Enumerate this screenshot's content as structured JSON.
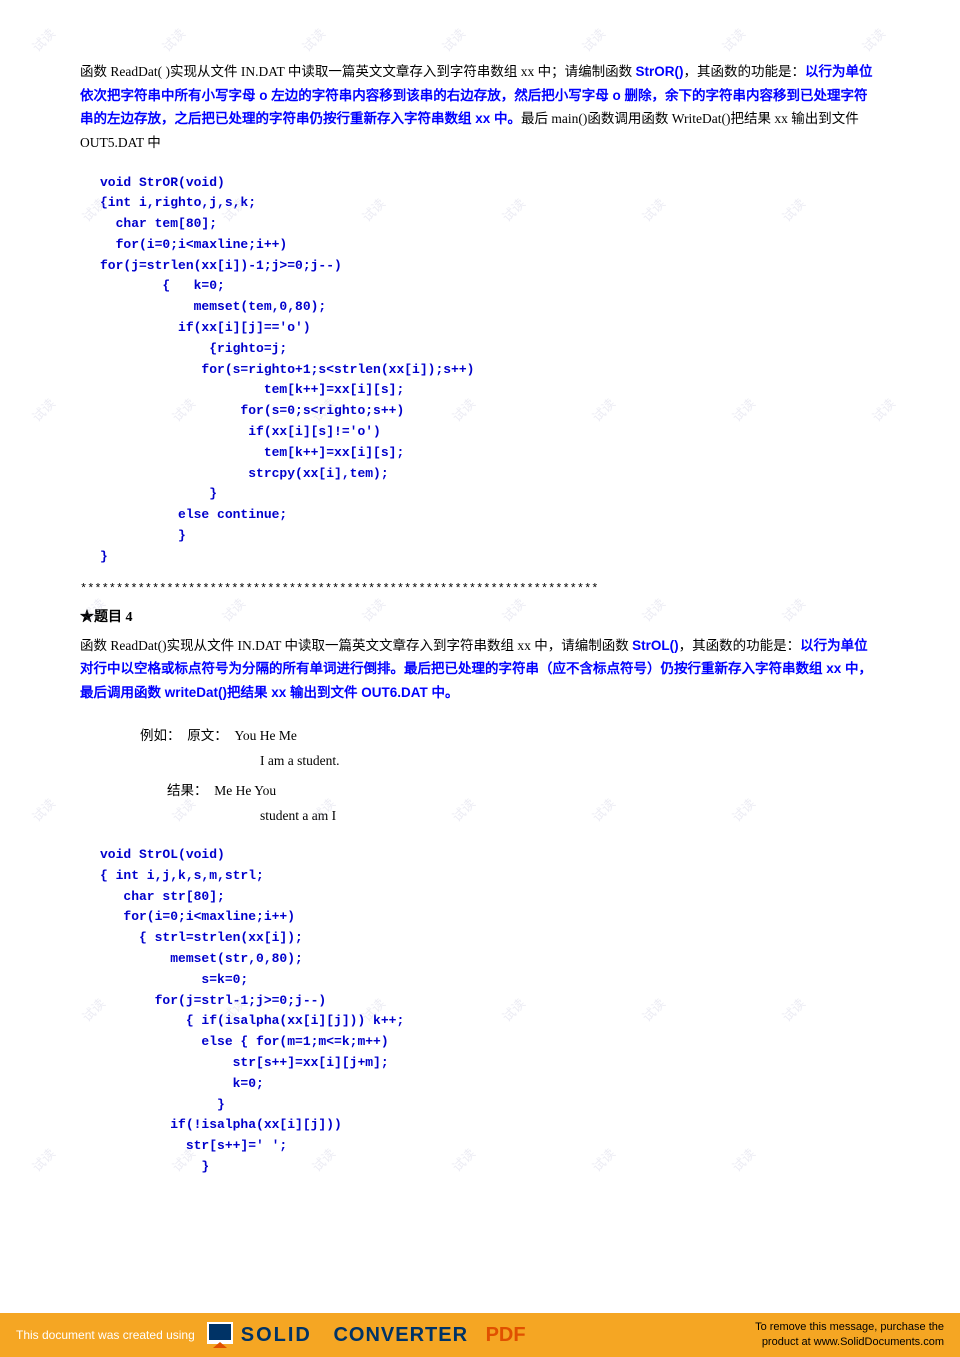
{
  "watermarks": [
    "试读",
    "试读"
  ],
  "section3": {
    "intro": "函数 ReadDat( )实现从文件 IN.DAT 中读取一篇英文文章存入到字符串数组 xx 中；请编制函数 StrOR()，其函数的功能是：以行为单位依次把字符串中所有小写字母 o 左边的字符串内容移到该串的右边存放，然后把小写字母 o 删除，余下的字符串内容移到已处理字符串的左边存放，之后把已处理的字符串仍按行重新存入字符串数组 xx 中。最后 main()函数调用函数 WriteDat()把结果 xx 输出到文件 OUT5.DAT 中",
    "bold_parts": [
      "StrOR()",
      "以行为单位依次把字符串中所有小写字母 o 左边的字符串内容移到该串的右边存放，然后把小写字母 o 删除，余下的字符串内容移到已处理字符串的左边存放，之后把已处理的字符串仍按行重新存入字符串数组 xx 中。最后 main()函数调用函数"
    ]
  },
  "code1": [
    "void StrOR(void)",
    "{int i,righto,j,s,k;",
    "  char tem[80];",
    "  for(i=0;i<maxline;i++)",
    "for(j=strlen(xx[i])-1;j>=0;j--)",
    "        {   k=0;",
    "            memset(tem,0,80);",
    "          if(xx[i][j]=='o')",
    "              {righto=j;",
    "             for(s=righto+1;s<strlen(xx[i]);s++)",
    "                     tem[k++]=xx[i][s];",
    "                  for(s=0;s<righto;s++)",
    "                   if(xx[i][s]!='o')",
    "                     tem[k++]=xx[i][s];",
    "                   strcpy(xx[i],tem);",
    "              }",
    "          else continue;",
    "          }",
    "}"
  ],
  "divider": "************************************************************************",
  "section4_title": "★题目 4",
  "section4_intro": "函数 ReadDat()实现从文件 IN.DAT 中读取一篇英文文章存入到字符串数组 xx 中，请编制函数 StrOL()，其函数的功能是：以行为单位对行中以空格或标点符号为分隔的所有单词进行倒排。最后把已处理的字符串（应不含标点符号）仍按行重新存入字符串数组 xx 中，最后调用函数 writeDat()把结果 xx 输出到文件 OUT6.DAT 中。",
  "section4_bold": [
    "StrOL()",
    "以行为单位对行中以空格或标点符号为分隔的所有单词进行倒排。最后把已处理的字符串（应不含标点符号）仍按行重新存入字符串数组 xx 中，最后调用函数 writeDat()把结果 xx 输出到文件 OUT6.DAT 中。"
  ],
  "example": {
    "label_yuanwen": "例如：  原文：",
    "yuanwen_line1": "You He Me",
    "yuanwen_line2": "I am a student.",
    "label_jieguo": "        结果：",
    "jieguo_line1": "Me He You",
    "jieguo_line2": "student a am I"
  },
  "code2": [
    "void StrOL(void)",
    "{ int i,j,k,s,m,strl;",
    "   char str[80];",
    "   for(i=0;i<maxline;i++)",
    "     { strl=strlen(xx[i]);",
    "         memset(str,0,80);",
    "             s=k=0;",
    "       for(j=strl-1;j>=0;j--)",
    "           { if(isalpha(xx[i][j])) k++;",
    "             else { for(m=1;m<=k;m++)",
    "                 str[s++]=xx[i][j+m];",
    "                 k=0;",
    "               }",
    "         if(!isalpha(xx[i][j]))",
    "           str[s++]=' ';",
    "             }"
  ],
  "footer": {
    "left_text": "This document was created using",
    "solid_text": "SOLID",
    "converter_text": "CONVERTER",
    "pdf_text": "PDF",
    "right_text": "To remove this message, purchase the\nproduct at www.SolidDocuments.com"
  }
}
